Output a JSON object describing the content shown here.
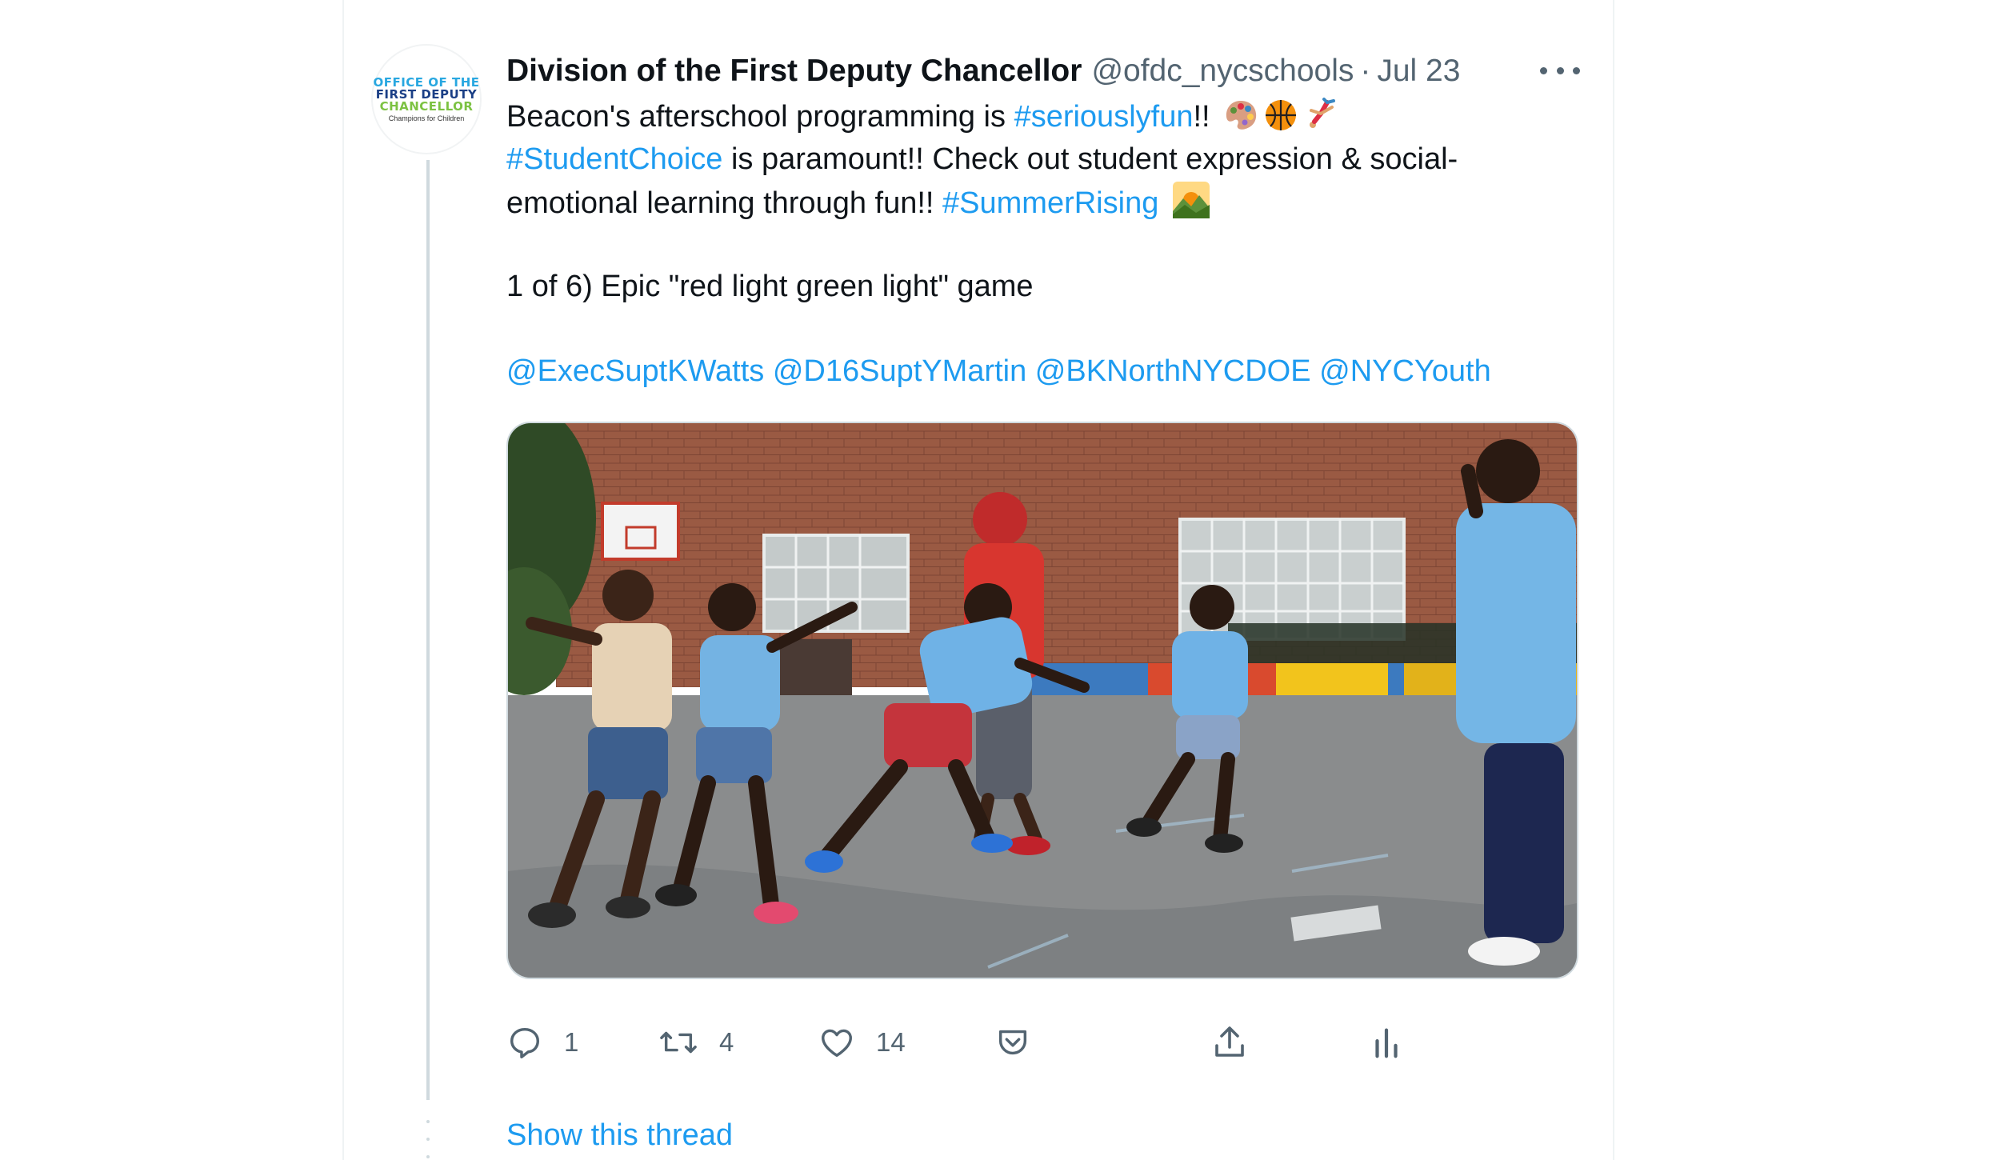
{
  "tweet": {
    "author_name": "Division of the First Deputy Chancellor",
    "handle": "@ofdc_nycschools",
    "separator": "·",
    "date": "Jul 23",
    "avatar": {
      "line1": "OFFICE OF THE",
      "line2": "FIRST DEPUTY",
      "line3": "CHANCELLOR",
      "line4": "Champions for Children"
    },
    "text": {
      "l1_prefix": "Beacon's afterschool programming is ",
      "l1_tag": "#seriouslyfun",
      "l1_suffix": "!!",
      "l2_tag": "#StudentChoice",
      "l2_text": " is paramount!! Check out student expression & social-",
      "l3_text": "emotional learning through fun!! ",
      "l3_tag": "#SummerRising",
      "l4_text": "1 of 6) Epic \"red light green light\" game",
      "mention1": "@ExecSuptKWatts",
      "mention2": "@D16SuptYMartin",
      "mention3": "@BKNorthNYCDOE",
      "mention4": "@NYCYouth"
    },
    "emojis": [
      "artist-palette-emoji",
      "basketball-emoji",
      "cartwheel-emoji",
      "sunrise-over-mountains-emoji"
    ],
    "media": {
      "icon": "photo-of-children-playing-red-light-green-light"
    },
    "actions": {
      "reply_count": "1",
      "retweet_count": "4",
      "like_count": "14"
    },
    "show_thread": "Show this thread"
  },
  "colors": {
    "link": "#1d9bf0",
    "secondary_text": "#536471",
    "primary_text": "#0f1419",
    "border": "#eff3f4"
  }
}
